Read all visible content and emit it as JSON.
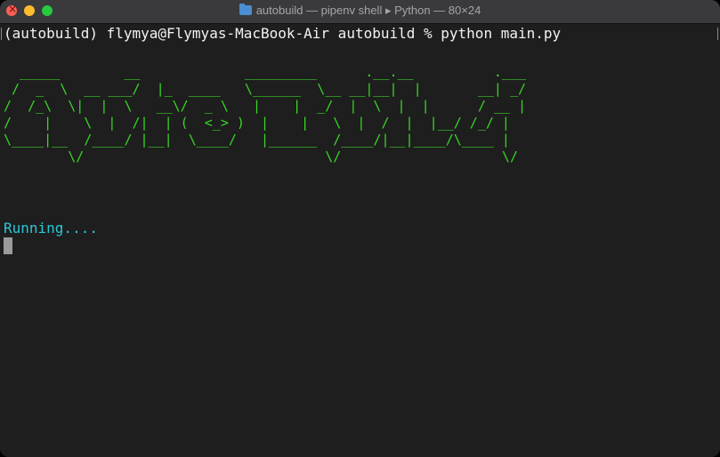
{
  "window": {
    "title": "autobuild — pipenv shell ▸ Python — 80×24",
    "folder_icon": "folder-icon",
    "controls": [
      "close",
      "minimize",
      "zoom"
    ]
  },
  "terminal": {
    "prompt": "(autobuild) flymya@Flymyas-MacBook-Air autobuild % python main.py",
    "ascii_art": [
      "  _____        __             _________      .__.__          .___",
      " /  _  \\  __ ___/  |_  ____   \\______  \\__ __|__|  |       __| _/",
      "/  /_\\  \\|  |  \\   __\\/  _ \\   |    |  _/  |  \\  |  |      / __ |",
      "/    |    \\  |  /|  | (  <_> )  |    |   \\  |  /  |  |__/ /_/ |",
      "\\____|__  /____/ |__|  \\____/   |______  /____/|__|____/\\____ |",
      "        \\/                              \\/                    \\/"
    ],
    "status": "Running....",
    "colors": {
      "background": "#1e1e1e",
      "prompt_text": "#f2f2f2",
      "ascii_art": "#39d627",
      "status_text": "#2bc7d6",
      "cursor": "#9a9a9a"
    }
  }
}
